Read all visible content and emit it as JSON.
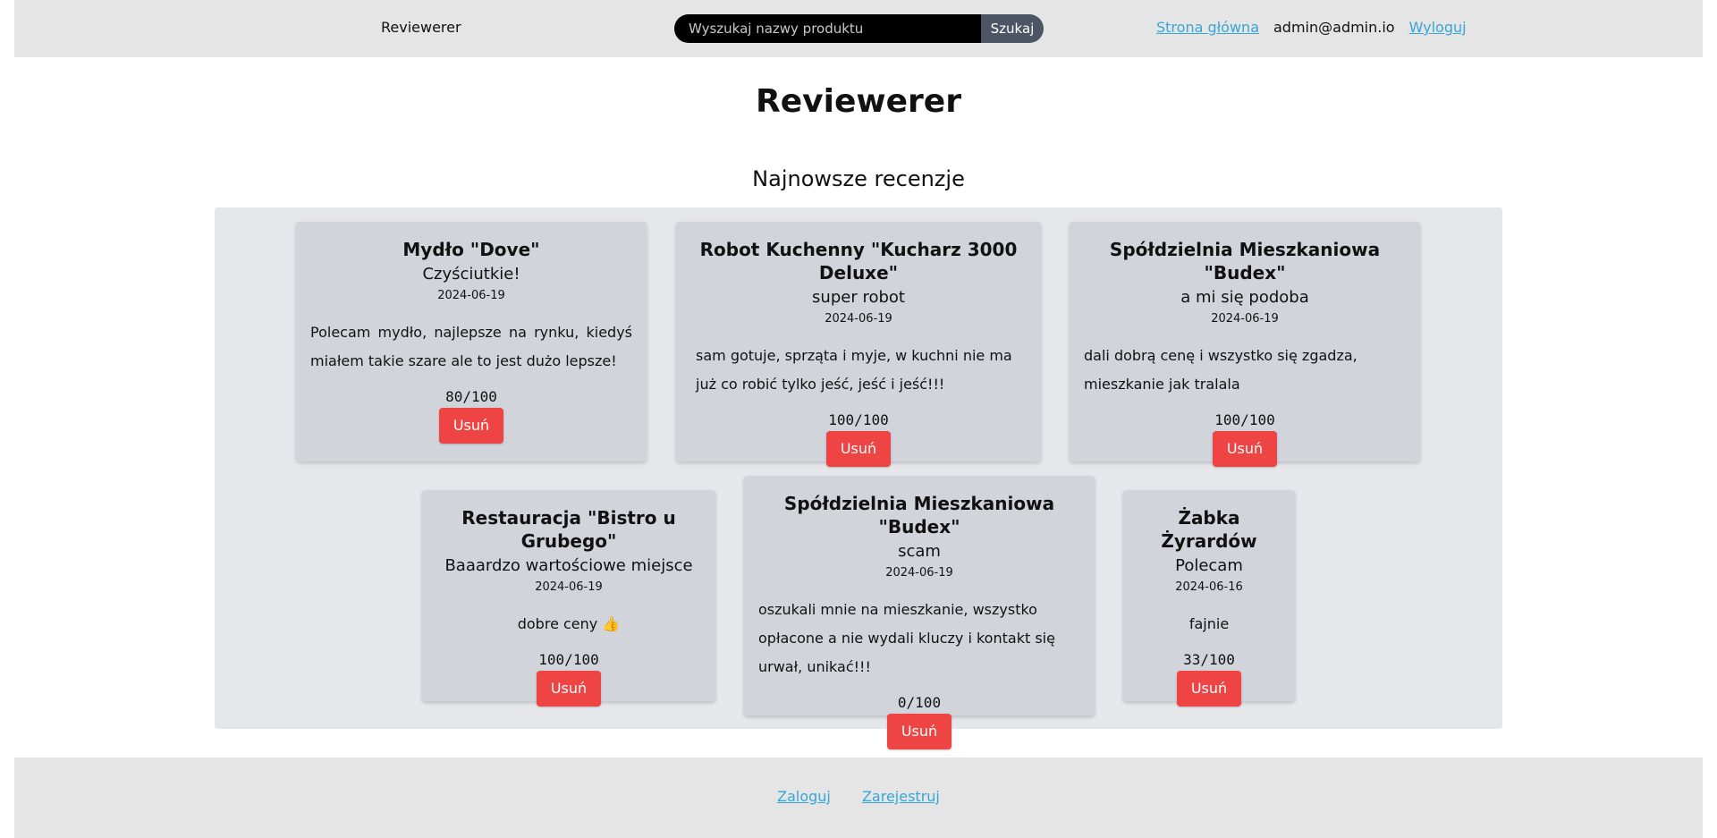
{
  "header": {
    "brand": "Reviewerer",
    "search": {
      "placeholder": "Wyszukaj nazwy produktu",
      "value": "",
      "button": "Szukaj"
    },
    "nav": {
      "home": "Strona główna",
      "user": "admin@admin.io",
      "logout": "Wyloguj"
    }
  },
  "main": {
    "title": "Reviewerer",
    "section_title": "Najnowsze recenzje"
  },
  "reviews": [
    {
      "product": "Mydło \"Dove\"",
      "headline": "Czyściutkie!",
      "date": "2024-06-19",
      "body": "Polecam mydło, najlepsze na rynku, kiedyś miałem takie szare ale to jest dużo lepsze!",
      "score": "80/100",
      "delete": "Usuń"
    },
    {
      "product": "Robot Kuchenny \"Kucharz 3000 Deluxe\"",
      "headline": "super robot",
      "date": "2024-06-19",
      "body": "sam gotuje, sprząta i myje, w kuchni nie ma już co robić tylko jeść, jeść i jeść!!!",
      "score": "100/100",
      "delete": "Usuń"
    },
    {
      "product": "Spółdzielnia Mieszkaniowa \"Budex\"",
      "headline": "a mi się podoba",
      "date": "2024-06-19",
      "body": "dali dobrą cenę i wszystko się zgadza, mieszkanie jak tralala",
      "score": "100/100",
      "delete": "Usuń"
    },
    {
      "product": "Restauracja \"Bistro u Grubego\"",
      "headline": "Baaardzo wartościowe miejsce",
      "date": "2024-06-19",
      "body": "dobre ceny 👍",
      "score": "100/100",
      "delete": "Usuń"
    },
    {
      "product": "Spółdzielnia Mieszkaniowa \"Budex\"",
      "headline": "scam",
      "date": "2024-06-19",
      "body": "oszukali mnie na mieszkanie, wszystko opłacone a nie wydali kluczy i kontakt się urwał, unikać!!!",
      "score": "0/100",
      "delete": "Usuń"
    },
    {
      "product": "Żabka Żyrardów",
      "headline": "Polecam",
      "date": "2024-06-16",
      "body": "fajnie",
      "score": "33/100",
      "delete": "Usuń"
    }
  ],
  "footer": {
    "login": "Zaloguj",
    "register": "Zarejestruj"
  },
  "colors": {
    "link": "#38a6d6",
    "delete_button": "#ef4444",
    "card": "#d1d5db",
    "panel": "#e5e7eb",
    "bar": "#e5e5e5"
  }
}
